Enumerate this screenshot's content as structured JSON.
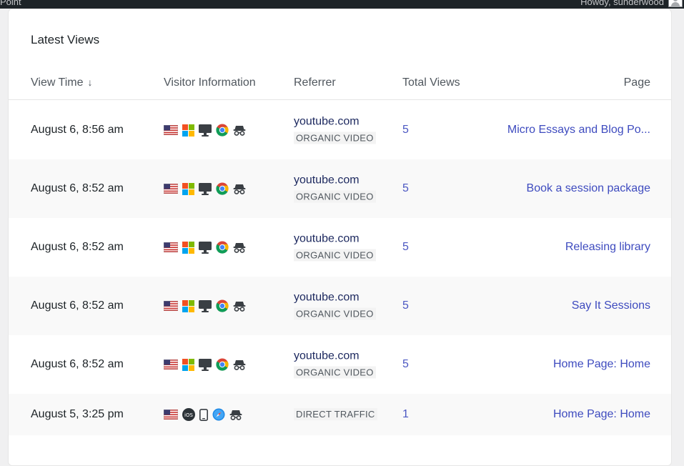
{
  "adminbar": {
    "site": "Point",
    "howdy": "Howdy, sunderwood"
  },
  "card": {
    "title": "Latest Views"
  },
  "columns": {
    "time": "View Time",
    "time_sort_icon": "↓",
    "visitor": "Visitor Information",
    "referrer": "Referrer",
    "total": "Total Views",
    "page": "Page"
  },
  "icons": {
    "flag": "us-flag-icon",
    "windows": "windows-icon",
    "desktop": "desktop-icon",
    "chrome": "chrome-icon",
    "incognito": "incognito-icon",
    "ios": "ios-icon",
    "mobile": "mobile-icon",
    "safari": "safari-icon"
  },
  "rows": [
    {
      "time": "August 6, 8:56 am",
      "domain": "youtube.com",
      "channel": "ORGANIC VIDEO",
      "views": "5",
      "page": "Micro Essays and Blog Po..."
    },
    {
      "time": "August 6, 8:52 am",
      "domain": "youtube.com",
      "channel": "ORGANIC VIDEO",
      "views": "5",
      "page": "Book a session package"
    },
    {
      "time": "August 6, 8:52 am",
      "domain": "youtube.com",
      "channel": "ORGANIC VIDEO",
      "views": "5",
      "page": "Releasing library"
    },
    {
      "time": "August 6, 8:52 am",
      "domain": "youtube.com",
      "channel": "ORGANIC VIDEO",
      "views": "5",
      "page": "Say It Sessions"
    },
    {
      "time": "August 6, 8:52 am",
      "domain": "youtube.com",
      "channel": "ORGANIC VIDEO",
      "views": "5",
      "page": "Home Page: Home"
    },
    {
      "time": "August 5, 3:25 pm",
      "domain": "",
      "channel": "DIRECT TRAFFIC",
      "views": "1",
      "page": "Home Page: Home"
    }
  ],
  "colors": {
    "link": "#3e4bbf",
    "domain": "#1e2a60",
    "alt_row": "#f9f9f9"
  }
}
